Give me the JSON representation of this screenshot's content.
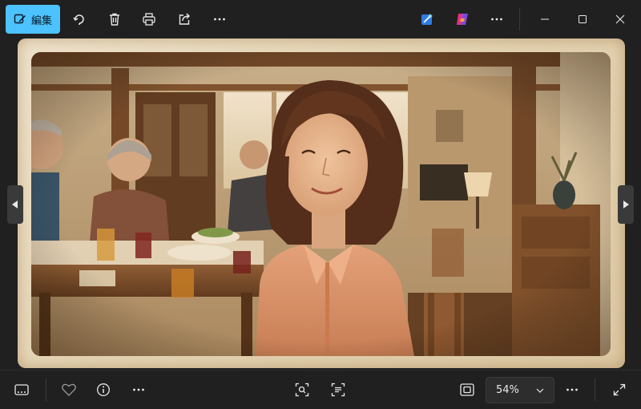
{
  "toolbar": {
    "edit_label": "編集"
  },
  "bottom": {
    "zoom_value": "54%"
  },
  "icons": {
    "edit": "edit-image-icon",
    "rotate": "rotate-icon",
    "delete": "delete-icon",
    "print": "print-icon",
    "share": "share-icon",
    "more": "more-icon",
    "ai_edit": "designer-icon",
    "copilot": "copilot-icon",
    "minimize": "minimize-icon",
    "maximize": "maximize-icon",
    "close": "close-icon",
    "filmstrip": "filmstrip-icon",
    "favorite": "heart-icon",
    "info": "info-icon",
    "visual_search": "visual-search-icon",
    "ocr": "text-scan-icon",
    "fit": "fit-to-window-icon",
    "fullscreen": "fullscreen-icon"
  },
  "colors": {
    "accent": "#4cc2ff",
    "background": "#202020"
  }
}
